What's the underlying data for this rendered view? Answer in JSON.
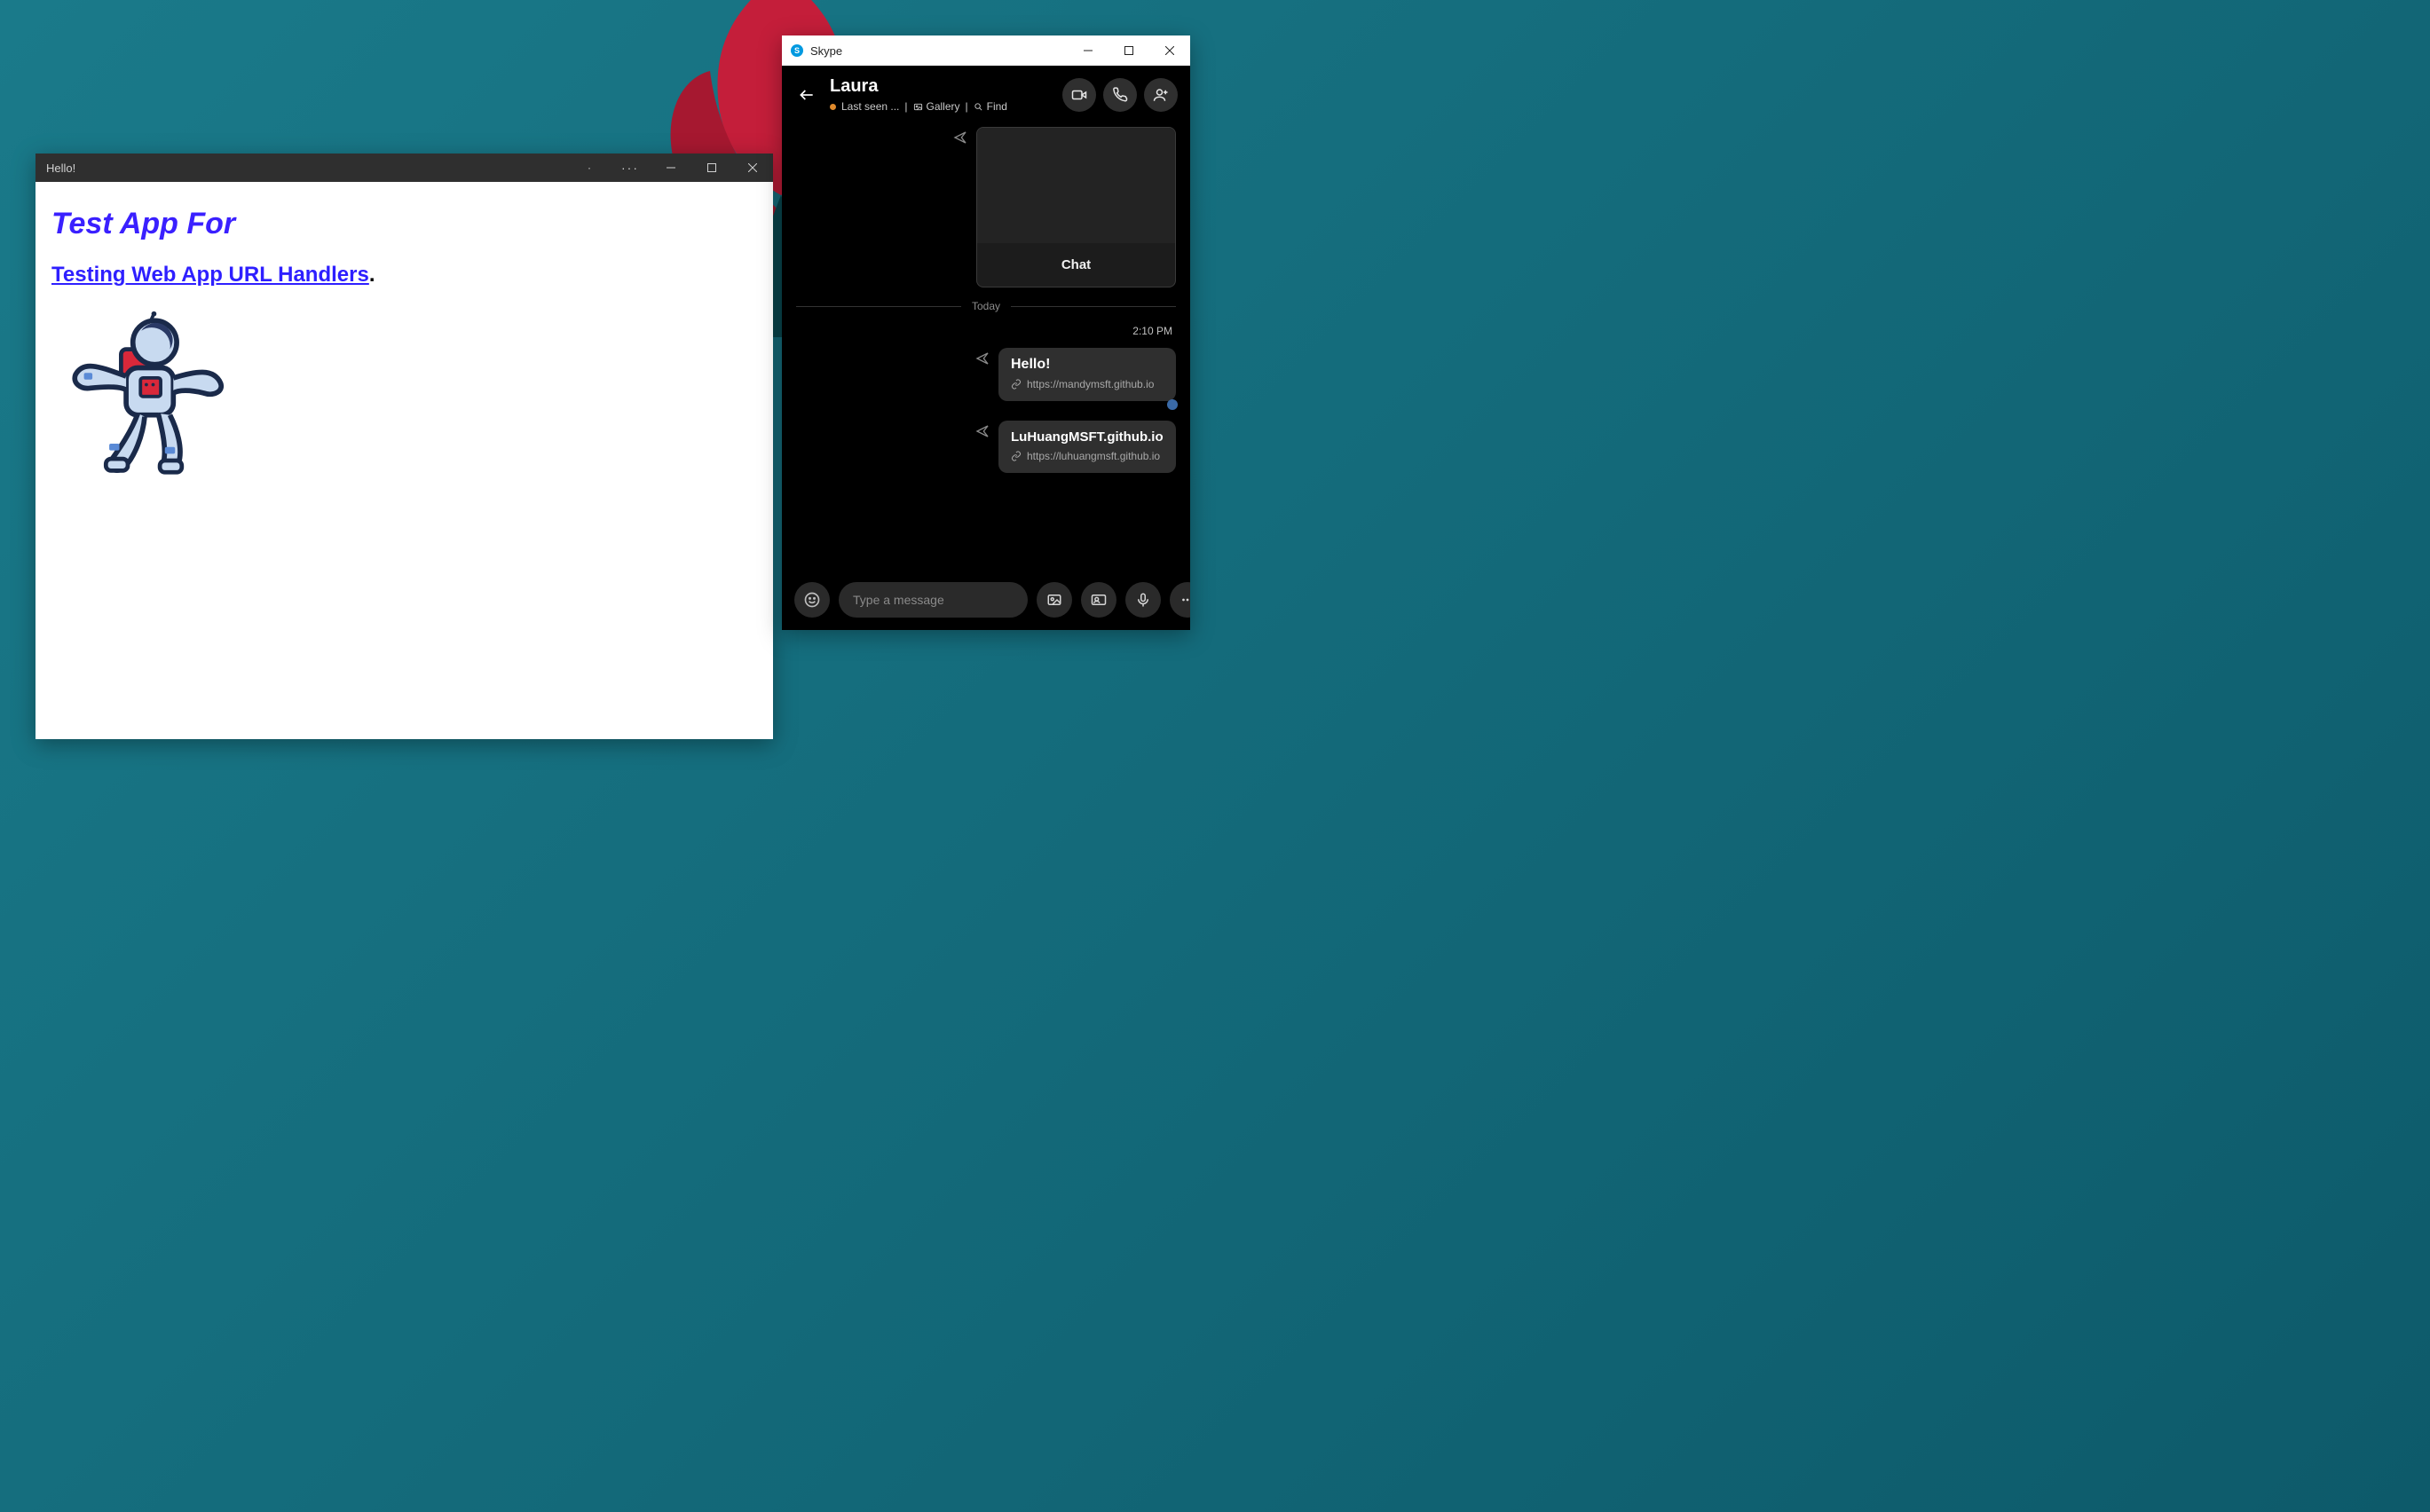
{
  "testApp": {
    "windowTitle": "Hello!",
    "heading": "Test App For",
    "linkText": "Testing Web App URL Handlers",
    "period": "."
  },
  "skype": {
    "appName": "Skype",
    "contact": {
      "name": "Laura",
      "statusText": "Last seen ...",
      "gallery": "Gallery",
      "find": "Find",
      "sep": "|"
    },
    "chatCard": {
      "label": "Chat"
    },
    "dateSeparator": "Today",
    "messages": [
      {
        "time": "2:10 PM",
        "title": "Hello!",
        "url": "https://mandymsft.github.io"
      },
      {
        "title": "LuHuangMSFT.github.io",
        "url": "https://luhuangmsft.github.io"
      }
    ],
    "composer": {
      "placeholder": "Type a message"
    }
  }
}
